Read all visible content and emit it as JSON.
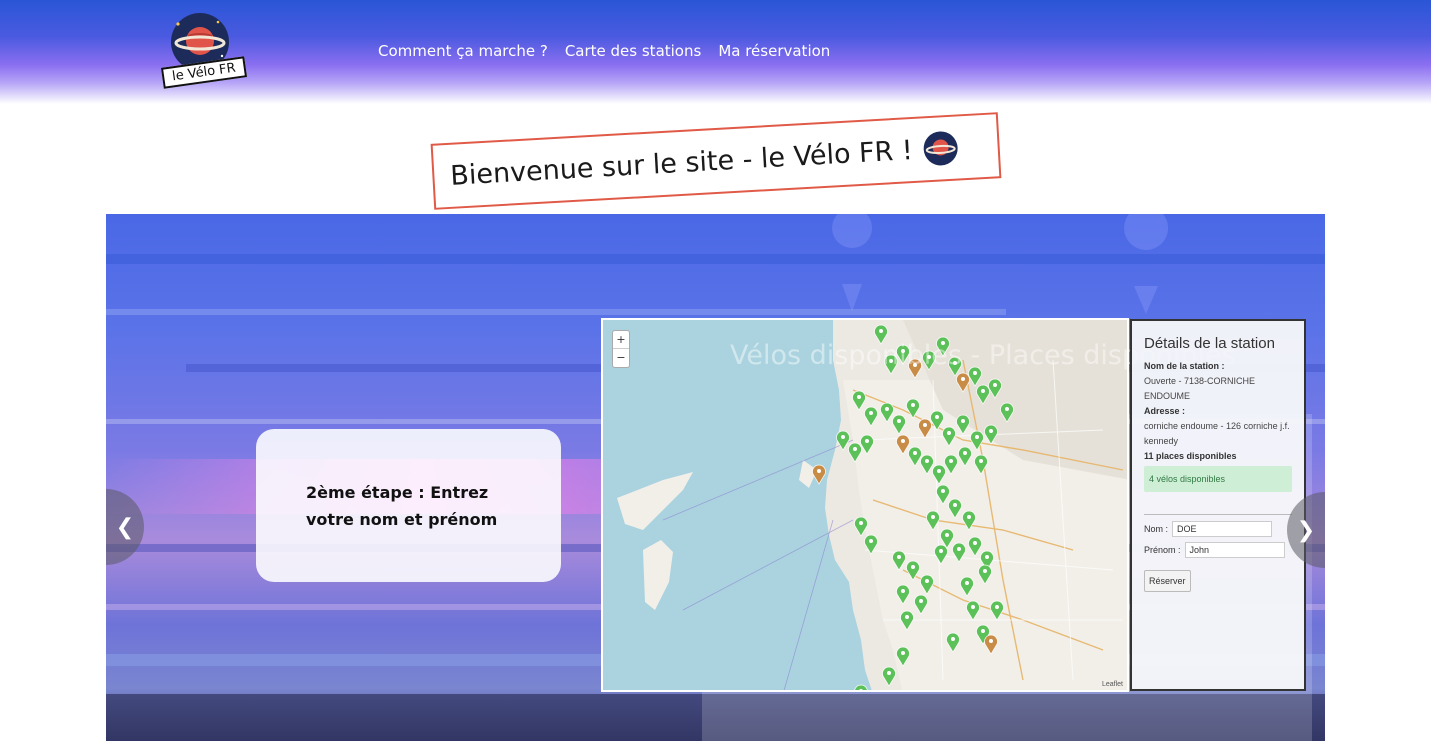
{
  "header": {
    "logo_text": "le Vélo FR",
    "nav": [
      "Comment ça marche ?",
      "Carte des stations",
      "Ma réservation"
    ]
  },
  "welcome": {
    "text": "Bienvenue sur le site - le Vélo FR !"
  },
  "slide": {
    "step_text": "2ème étape : Entrez votre nom et prénom",
    "prev_icon": "chevron-left-icon",
    "next_icon": "chevron-right-icon",
    "watermark_text": "Vélos disponibles - Places disponibles"
  },
  "map": {
    "zoom_in": "+",
    "zoom_out": "−",
    "attribution": "Leaflet",
    "marker_colors": {
      "available": "#5dc15a",
      "unavailable": "#c98c47"
    }
  },
  "details": {
    "title": "Détails de la station",
    "name_label": "Nom de la station :",
    "name_value": "Ouverte - 7138-CORNICHE ENDOUME",
    "address_label": "Adresse :",
    "address_value": "corniche endoume - 126 corniche j.f. kennedy",
    "places": "11 places disponibles",
    "bikes": "4 vélos disponibles",
    "nom_label": "Nom :",
    "nom_value": "DOE",
    "prenom_label": "Prénom :",
    "prenom_value": "John",
    "reserve_label": "Réserver"
  },
  "colors": {
    "header_top": "#2a56d6",
    "header_bottom": "#b7a6f7",
    "stamp_border": "#e05a47"
  }
}
